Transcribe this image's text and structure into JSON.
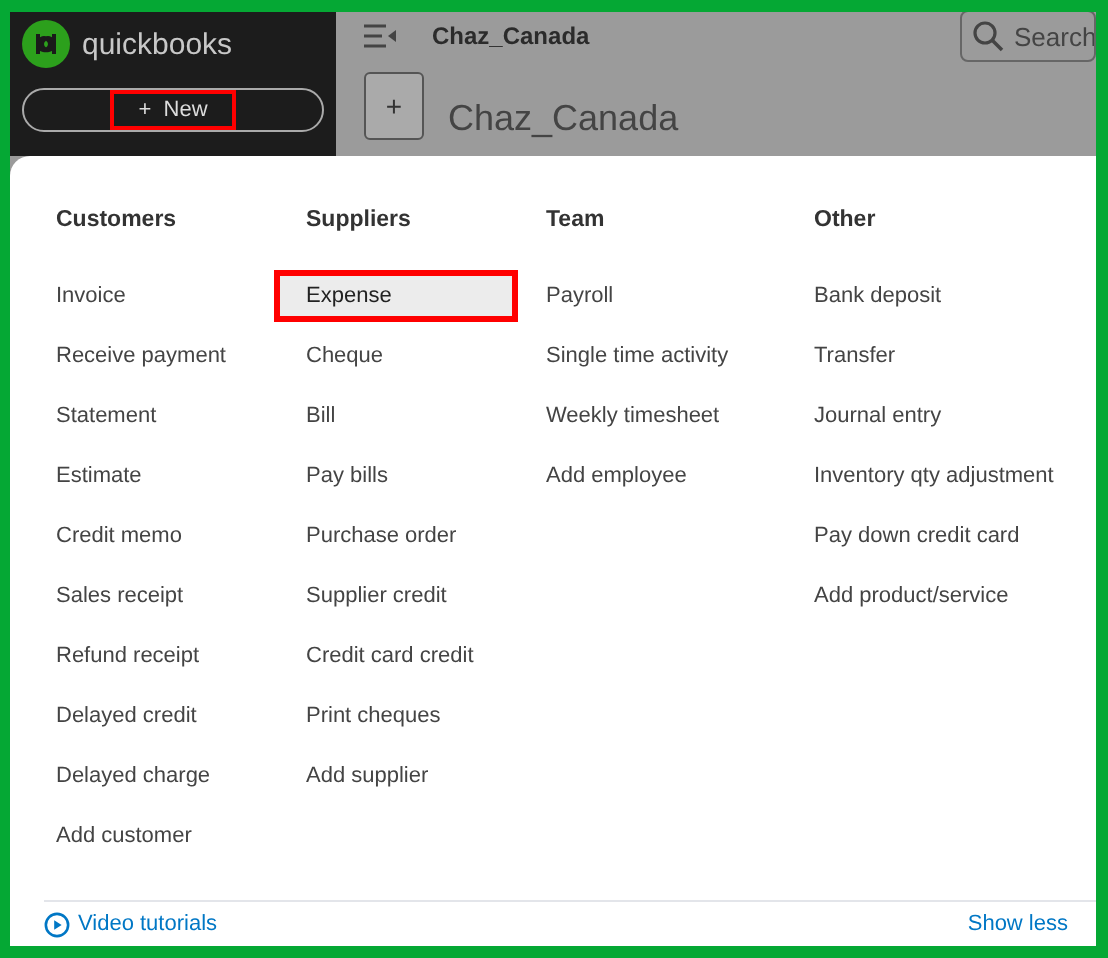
{
  "sidebar": {
    "logo_text": "quickbooks",
    "new_button": {
      "label": "New",
      "icon": "+",
      "highlighted": true
    }
  },
  "header": {
    "company": "Chaz_Canada",
    "search": {
      "placeholder": "Search"
    },
    "page_title": "Chaz_Canada",
    "add_label": "+"
  },
  "menu": {
    "columns": [
      {
        "heading": "Customers",
        "items": [
          {
            "label": "Invoice",
            "selected": false
          },
          {
            "label": "Receive payment",
            "selected": false
          },
          {
            "label": "Statement",
            "selected": false
          },
          {
            "label": "Estimate",
            "selected": false
          },
          {
            "label": "Credit memo",
            "selected": false
          },
          {
            "label": "Sales receipt",
            "selected": false
          },
          {
            "label": "Refund receipt",
            "selected": false
          },
          {
            "label": "Delayed credit",
            "selected": false
          },
          {
            "label": "Delayed charge",
            "selected": false
          },
          {
            "label": "Add customer",
            "selected": false
          }
        ]
      },
      {
        "heading": "Suppliers",
        "items": [
          {
            "label": "Expense",
            "selected": true
          },
          {
            "label": "Cheque",
            "selected": false
          },
          {
            "label": "Bill",
            "selected": false
          },
          {
            "label": "Pay bills",
            "selected": false
          },
          {
            "label": "Purchase order",
            "selected": false
          },
          {
            "label": "Supplier credit",
            "selected": false
          },
          {
            "label": "Credit card credit",
            "selected": false
          },
          {
            "label": "Print cheques",
            "selected": false
          },
          {
            "label": "Add supplier",
            "selected": false
          }
        ]
      },
      {
        "heading": "Team",
        "items": [
          {
            "label": "Payroll",
            "selected": false
          },
          {
            "label": "Single time activity",
            "selected": false
          },
          {
            "label": "Weekly timesheet",
            "selected": false
          },
          {
            "label": "Add employee",
            "selected": false
          }
        ]
      },
      {
        "heading": "Other",
        "items": [
          {
            "label": "Bank deposit",
            "selected": false
          },
          {
            "label": "Transfer",
            "selected": false
          },
          {
            "label": "Journal entry",
            "selected": false
          },
          {
            "label": "Inventory qty adjustment",
            "selected": false
          },
          {
            "label": "Pay down credit card",
            "selected": false
          },
          {
            "label": "Add product/service",
            "selected": false
          }
        ]
      }
    ],
    "footer": {
      "tutorials_link": "Video tutorials",
      "toggle_link": "Show less"
    }
  }
}
